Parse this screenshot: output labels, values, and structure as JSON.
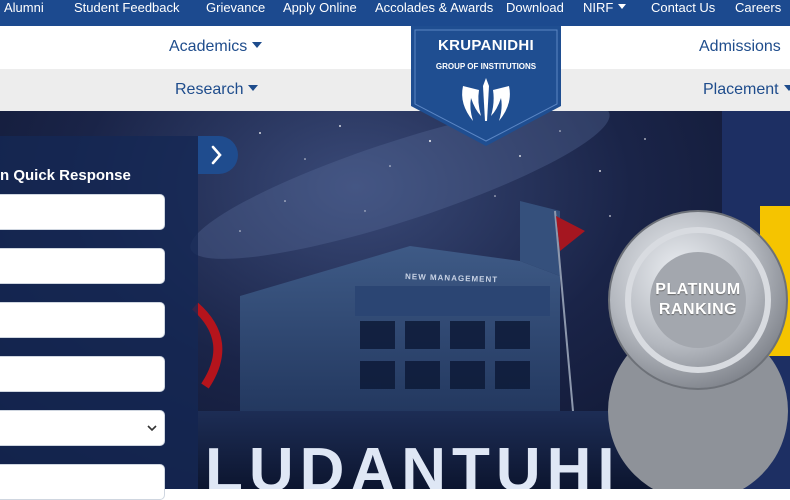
{
  "topbar": {
    "links": [
      "Alumni",
      "Student Feedback",
      "Grievance",
      "Apply Online",
      "Accolades & Awards",
      "Download",
      "NIRF",
      "Contact Us",
      "Careers"
    ]
  },
  "nav": {
    "academics": "Academics",
    "admissions": "Admissions",
    "research": "Research",
    "placement": "Placement"
  },
  "logo": {
    "title": "KRUPANIDHI",
    "subtitle": "GROUP OF INSTITUTIONS"
  },
  "form": {
    "title": "n Quick Response",
    "fields": [
      "",
      "",
      "",
      ""
    ],
    "select_value": ""
  },
  "hero": {
    "building_sign": "NEW MANAGEMENT",
    "campus_letters": "LUDANTUHI"
  },
  "badge": {
    "line1": "PLATINUM",
    "line2": "RANKING"
  },
  "colors": {
    "brand_blue": "#1c4a8f",
    "nav_text": "#1e4c8c",
    "ribbon_red": "#c8141c",
    "accent_yellow": "#f5c400",
    "silver": "#b9bcc2"
  }
}
